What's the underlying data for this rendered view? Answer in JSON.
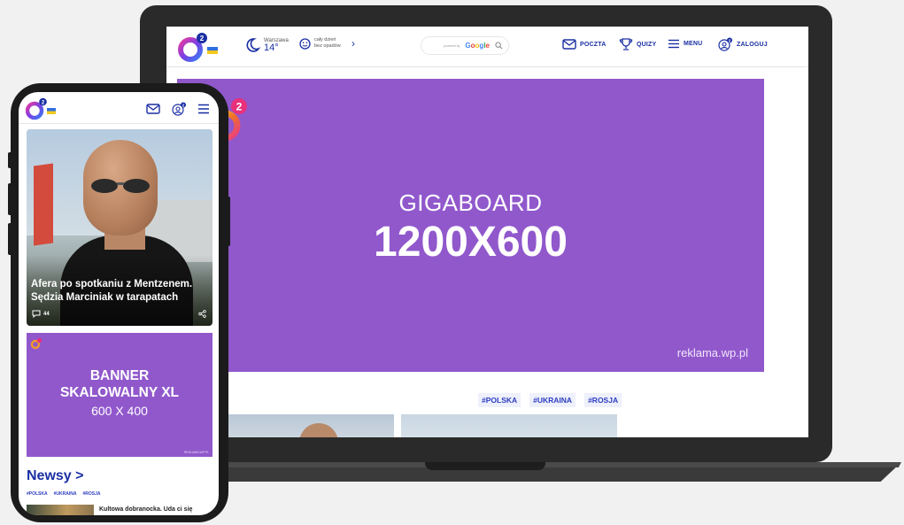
{
  "desktop": {
    "weather": {
      "city": "Warszawa",
      "temp": "14°",
      "forecast": "cały dzień bez opadów"
    },
    "search": {
      "powered_by": "powered by",
      "brand": "Google"
    },
    "nav": {
      "poczta": "POCZTA",
      "quizy": "QUIZY",
      "menu": "MENU",
      "zaloguj": "ZALOGUJ"
    },
    "ad": {
      "line1": "GIGABOARD",
      "line2": "1200X600",
      "source": "reklama.wp.pl"
    },
    "tags": [
      "#POLSKA",
      "#UKRAINA",
      "#ROSJA"
    ]
  },
  "mobile": {
    "hero": {
      "title": "Afera po spotkaniu z Mentzenem. Sędzia Marciniak w tarapatach",
      "comments": "44"
    },
    "banner": {
      "line1": "BANNER",
      "line2": "SKALOWALNY XL",
      "line3": "600 X 400",
      "source": "REKLAMA.WP.PL"
    },
    "news": {
      "heading": "Newsy >",
      "tags": [
        "#POLSKA",
        "#UKRAINA",
        "#ROSJA"
      ],
      "story_title": "Kultowa dobranocka. Uda ci się"
    }
  },
  "colors": {
    "brand_blue": "#1a2fa3",
    "ad_purple": "#9158cc",
    "tag_blue": "#2d3dc1"
  }
}
